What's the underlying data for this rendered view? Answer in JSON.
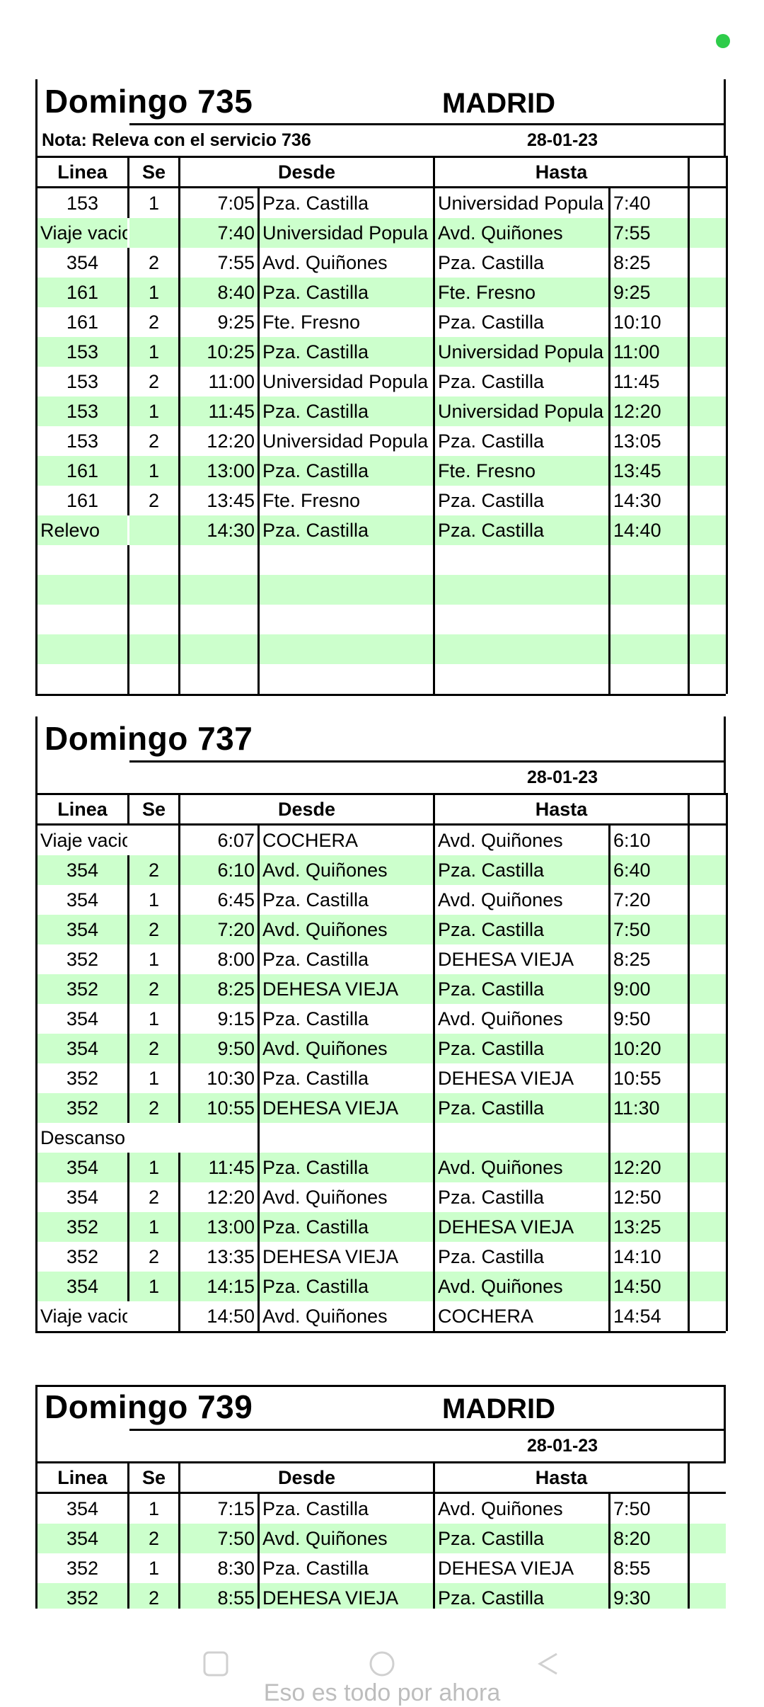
{
  "status": {
    "indicator_color": "#2ecc4a"
  },
  "colors": {
    "stripe": "#ccffcc"
  },
  "blocks": [
    {
      "title": "Domingo 735",
      "city": "MADRID",
      "note": "Nota: Releva con el servicio 736",
      "date": "28-01-23",
      "headers": {
        "linea": "Linea",
        "se": "Se",
        "desde": "Desde",
        "hasta": "Hasta"
      },
      "rows": [
        {
          "linea": "153",
          "se": "1",
          "t1": "7:05",
          "desde": "Pza. Castilla",
          "hasta": "Universidad Popula",
          "t2": "7:40"
        },
        {
          "linea": "Viaje vacio",
          "se": "",
          "t1": "7:40",
          "desde": "Universidad Popula",
          "hasta": "Avd. Quiñones",
          "t2": "7:55"
        },
        {
          "linea": "354",
          "se": "2",
          "t1": "7:55",
          "desde": "Avd. Quiñones",
          "hasta": "Pza. Castilla",
          "t2": "8:25"
        },
        {
          "linea": "161",
          "se": "1",
          "t1": "8:40",
          "desde": "Pza. Castilla",
          "hasta": "Fte. Fresno",
          "t2": "9:25"
        },
        {
          "linea": "161",
          "se": "2",
          "t1": "9:25",
          "desde": "Fte. Fresno",
          "hasta": "Pza. Castilla",
          "t2": "10:10"
        },
        {
          "linea": "153",
          "se": "1",
          "t1": "10:25",
          "desde": "Pza. Castilla",
          "hasta": "Universidad Popula",
          "t2": "11:00"
        },
        {
          "linea": "153",
          "se": "2",
          "t1": "11:00",
          "desde": "Universidad Popula",
          "hasta": "Pza. Castilla",
          "t2": "11:45"
        },
        {
          "linea": "153",
          "se": "1",
          "t1": "11:45",
          "desde": "Pza. Castilla",
          "hasta": "Universidad Popula",
          "t2": "12:20"
        },
        {
          "linea": "153",
          "se": "2",
          "t1": "12:20",
          "desde": "Universidad Popula",
          "hasta": "Pza. Castilla",
          "t2": "13:05"
        },
        {
          "linea": "161",
          "se": "1",
          "t1": "13:00",
          "desde": "Pza. Castilla",
          "hasta": "Fte. Fresno",
          "t2": "13:45"
        },
        {
          "linea": "161",
          "se": "2",
          "t1": "13:45",
          "desde": "Fte. Fresno",
          "hasta": "Pza. Castilla",
          "t2": "14:30"
        },
        {
          "linea": "Relevo",
          "se": "",
          "t1": "14:30",
          "desde": "Pza. Castilla",
          "hasta": "Pza. Castilla",
          "t2": "14:40"
        },
        {
          "linea": "",
          "se": "",
          "t1": "",
          "desde": "",
          "hasta": "",
          "t2": ""
        },
        {
          "linea": "",
          "se": "",
          "t1": "",
          "desde": "",
          "hasta": "",
          "t2": ""
        },
        {
          "linea": "",
          "se": "",
          "t1": "",
          "desde": "",
          "hasta": "",
          "t2": ""
        },
        {
          "linea": "",
          "se": "",
          "t1": "",
          "desde": "",
          "hasta": "",
          "t2": ""
        },
        {
          "linea": "",
          "se": "",
          "t1": "",
          "desde": "",
          "hasta": "",
          "t2": ""
        }
      ]
    },
    {
      "title": "Domingo 737",
      "city": "",
      "note": "",
      "date": "28-01-23",
      "headers": {
        "linea": "Linea",
        "se": "Se",
        "desde": "Desde",
        "hasta": "Hasta"
      },
      "rows": [
        {
          "linea": "Viaje vacio",
          "se": "",
          "t1": "6:07",
          "desde": "COCHERA",
          "hasta": "Avd. Quiñones",
          "t2": "6:10"
        },
        {
          "linea": "354",
          "se": "2",
          "t1": "6:10",
          "desde": "Avd. Quiñones",
          "hasta": "Pza. Castilla",
          "t2": "6:40"
        },
        {
          "linea": "354",
          "se": "1",
          "t1": "6:45",
          "desde": "Pza. Castilla",
          "hasta": "Avd. Quiñones",
          "t2": "7:20"
        },
        {
          "linea": "354",
          "se": "2",
          "t1": "7:20",
          "desde": "Avd. Quiñones",
          "hasta": "Pza. Castilla",
          "t2": "7:50"
        },
        {
          "linea": "352",
          "se": "1",
          "t1": "8:00",
          "desde": "Pza. Castilla",
          "hasta": "DEHESA VIEJA",
          "t2": "8:25"
        },
        {
          "linea": "352",
          "se": "2",
          "t1": "8:25",
          "desde": "DEHESA VIEJA",
          "hasta": "Pza. Castilla",
          "t2": "9:00"
        },
        {
          "linea": "354",
          "se": "1",
          "t1": "9:15",
          "desde": "Pza. Castilla",
          "hasta": "Avd. Quiñones",
          "t2": "9:50"
        },
        {
          "linea": "354",
          "se": "2",
          "t1": "9:50",
          "desde": "Avd. Quiñones",
          "hasta": "Pza. Castilla",
          "t2": "10:20"
        },
        {
          "linea": "352",
          "se": "1",
          "t1": "10:30",
          "desde": "Pza. Castilla",
          "hasta": "DEHESA VIEJA",
          "t2": "10:55"
        },
        {
          "linea": "352",
          "se": "2",
          "t1": "10:55",
          "desde": "DEHESA VIEJA",
          "hasta": "Pza. Castilla",
          "t2": "11:30"
        },
        {
          "linea": "Descanso",
          "se": "",
          "t1": "",
          "desde": "",
          "hasta": "",
          "t2": ""
        },
        {
          "linea": "354",
          "se": "1",
          "t1": "11:45",
          "desde": "Pza. Castilla",
          "hasta": "Avd. Quiñones",
          "t2": "12:20"
        },
        {
          "linea": "354",
          "se": "2",
          "t1": "12:20",
          "desde": "Avd. Quiñones",
          "hasta": "Pza. Castilla",
          "t2": "12:50"
        },
        {
          "linea": "352",
          "se": "1",
          "t1": "13:00",
          "desde": "Pza. Castilla",
          "hasta": "DEHESA VIEJA",
          "t2": "13:25"
        },
        {
          "linea": "352",
          "se": "2",
          "t1": "13:35",
          "desde": "DEHESA VIEJA",
          "hasta": "Pza. Castilla",
          "t2": "14:10"
        },
        {
          "linea": "354",
          "se": "1",
          "t1": "14:15",
          "desde": "Pza. Castilla",
          "hasta": "Avd. Quiñones",
          "t2": "14:50"
        },
        {
          "linea": "Viaje vacio",
          "se": "",
          "t1": "14:50",
          "desde": "Avd. Quiñones",
          "hasta": "COCHERA",
          "t2": "14:54"
        }
      ]
    },
    {
      "title": "Domingo 739",
      "city": "MADRID",
      "note": "",
      "date": "28-01-23",
      "headers": {
        "linea": "Linea",
        "se": "Se",
        "desde": "Desde",
        "hasta": "Hasta"
      },
      "rows": [
        {
          "linea": "354",
          "se": "1",
          "t1": "7:15",
          "desde": "Pza. Castilla",
          "hasta": "Avd. Quiñones",
          "t2": "7:50"
        },
        {
          "linea": "354",
          "se": "2",
          "t1": "7:50",
          "desde": "Avd. Quiñones",
          "hasta": "Pza. Castilla",
          "t2": "8:20"
        },
        {
          "linea": "352",
          "se": "1",
          "t1": "8:30",
          "desde": "Pza. Castilla",
          "hasta": "DEHESA VIEJA",
          "t2": "8:55"
        },
        {
          "linea": "352",
          "se": "2",
          "t1": "8:55",
          "desde": "DEHESA VIEJA",
          "hasta": "Pza. Castilla",
          "t2": "9:30"
        }
      ]
    }
  ],
  "toast": {
    "text": "Eso es todo por ahora"
  }
}
